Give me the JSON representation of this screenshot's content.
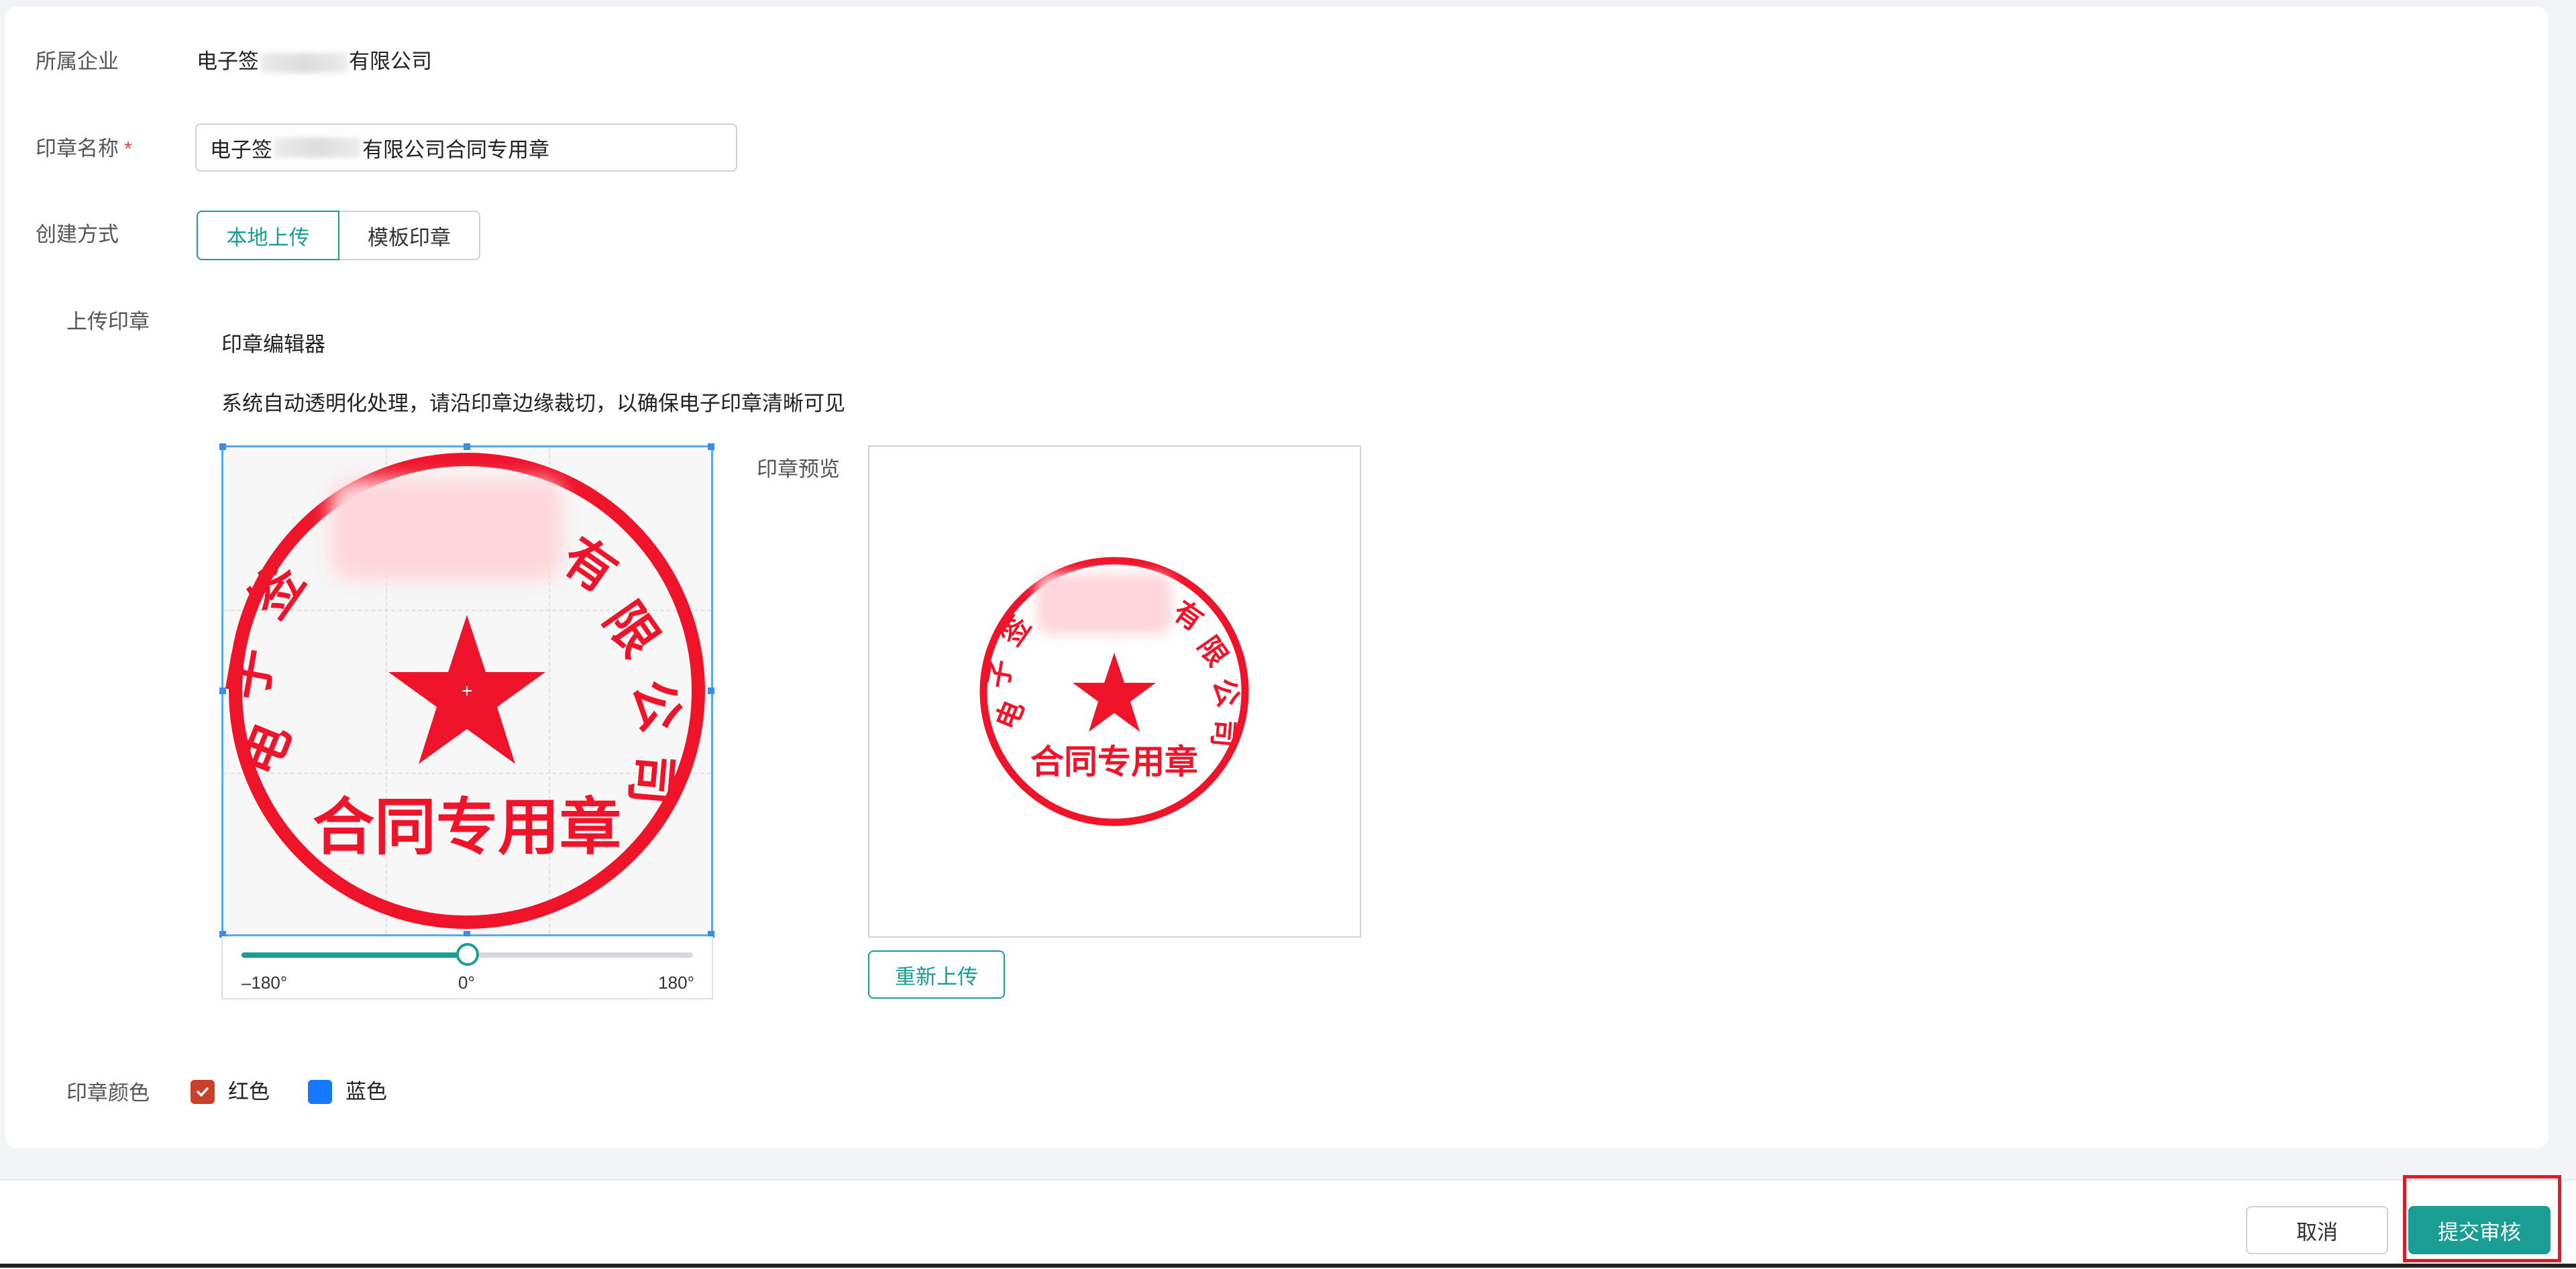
{
  "colors": {
    "accent": "#1a9e94",
    "seal_red": "#f0142b",
    "blue": "#1677ff",
    "checkbox_red": "#c9402b",
    "highlight": "#e01b24"
  },
  "form": {
    "company_label": "所属企业",
    "company_prefix": "电子签",
    "company_suffix": "有限公司",
    "seal_name_label": "印章名称",
    "required_mark": "*",
    "seal_name_prefix": "电子签",
    "seal_name_suffix": "有限公司合同专用章",
    "create_method_label": "创建方式",
    "create_options": [
      "本地上传",
      "模板印章"
    ],
    "selected_option": "本地上传",
    "upload_label": "上传印章",
    "editor_title": "印章编辑器",
    "editor_hint": "系统自动透明化处理，请沿印章边缘裁切，以确保电子印章清晰可见",
    "preview_label": "印章预览",
    "reupload_label": "重新上传",
    "color_label": "印章颜色",
    "color_options": [
      {
        "label": "红色",
        "checked": true,
        "color": "#c9402b"
      },
      {
        "label": "蓝色",
        "checked": false,
        "color": "#1677ff"
      }
    ]
  },
  "rotation": {
    "min": -180,
    "max": 180,
    "value": 0,
    "tick_min": "–180°",
    "tick_mid": "0°",
    "tick_max": "180°"
  },
  "seal": {
    "left_text": "电子签",
    "right_text": "有限公司",
    "bottom_text": "合同专用章"
  },
  "footer": {
    "cancel_label": "取消",
    "submit_label": "提交审核"
  }
}
